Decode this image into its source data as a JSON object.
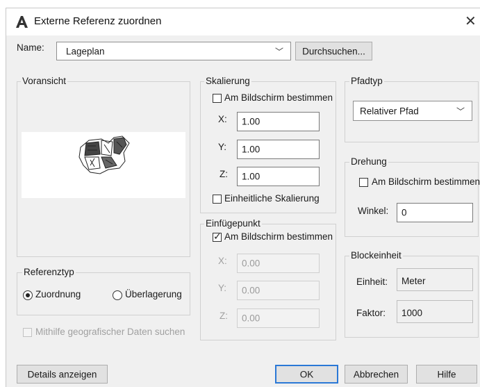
{
  "window": {
    "title": "Externe Referenz zuordnen",
    "close_glyph": "✕"
  },
  "name_row": {
    "label": "Name:",
    "value": "Lageplan",
    "browse_label": "Durchsuchen..."
  },
  "preview": {
    "label": "Voransicht"
  },
  "scale": {
    "label": "Skalierung",
    "on_screen_label": "Am Bildschirm bestimmen",
    "on_screen_checked": false,
    "x_label": "X:",
    "x_value": "1.00",
    "y_label": "Y:",
    "y_value": "1.00",
    "z_label": "Z:",
    "z_value": "1.00",
    "uniform_label": "Einheitliche Skalierung",
    "uniform_checked": false
  },
  "insertion": {
    "label": "Einfügepunkt",
    "on_screen_label": "Am Bildschirm bestimmen",
    "on_screen_checked": true,
    "check_glyph": "✓",
    "x_label": "X:",
    "x_value": "0.00",
    "y_label": "Y:",
    "y_value": "0.00",
    "z_label": "Z:",
    "z_value": "0.00"
  },
  "path_type": {
    "label": "Pfadtyp",
    "value": "Relativer Pfad"
  },
  "rotation": {
    "label": "Drehung",
    "on_screen_label": "Am Bildschirm bestimmen",
    "on_screen_checked": false,
    "angle_label": "Winkel:",
    "angle_value": "0"
  },
  "block_unit": {
    "label": "Blockeinheit",
    "unit_label": "Einheit:",
    "unit_value": "Meter",
    "factor_label": "Faktor:",
    "factor_value": "1000"
  },
  "reference_type": {
    "label": "Referenztyp",
    "attach_label": "Zuordnung",
    "overlay_label": "Überlagerung",
    "selected": "Zuordnung"
  },
  "geo": {
    "label": "Mithilfe geografischer Daten suchen",
    "checked": false
  },
  "buttons": {
    "details": "Details anzeigen",
    "ok": "OK",
    "cancel": "Abbrechen",
    "help": "Hilfe"
  },
  "icons": {
    "app": "autocad-a-icon",
    "dropdown": "chevron-down-icon"
  },
  "colors": {
    "default_button_border": "#2a78d6",
    "dialog_bg": "#f0f0f0"
  }
}
